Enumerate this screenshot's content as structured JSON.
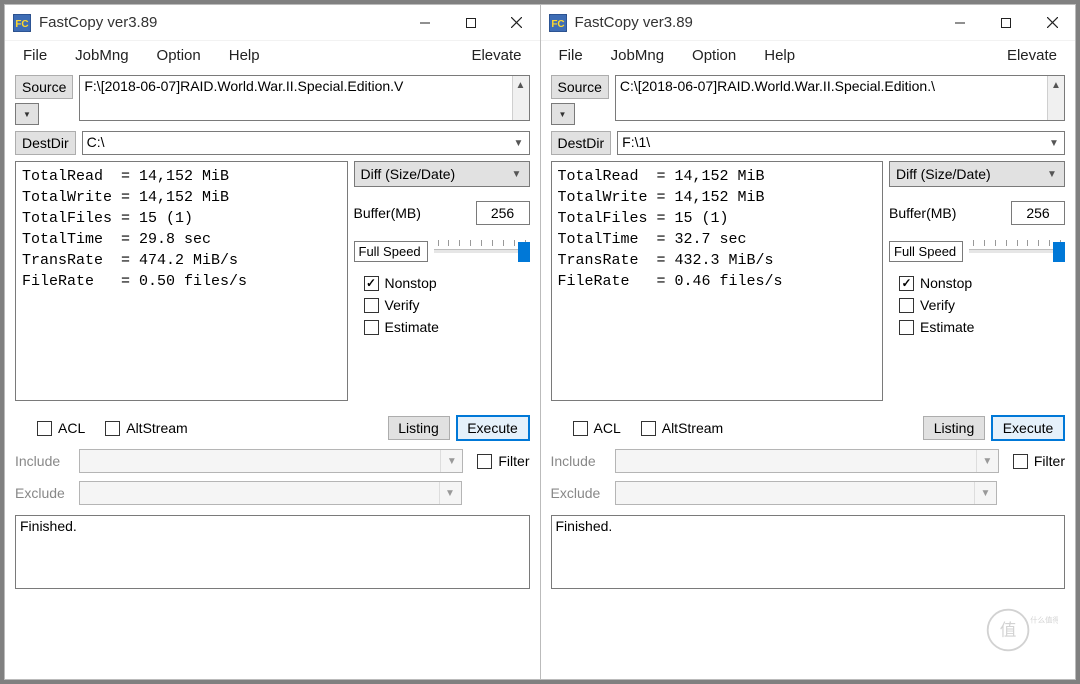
{
  "app": {
    "title": "FastCopy ver3.89",
    "menu": {
      "file": "File",
      "jobmng": "JobMng",
      "option": "Option",
      "help": "Help",
      "elevate": "Elevate"
    },
    "labels": {
      "source_btn": "Source",
      "destdir_btn": "DestDir",
      "buffer_label": "Buffer(MB)",
      "listing_btn": "Listing",
      "execute_btn": "Execute",
      "include_label": "Include",
      "exclude_label": "Exclude",
      "acl_label": "ACL",
      "altstream_label": "AltStream",
      "nonstop_label": "Nonstop",
      "verify_label": "Verify",
      "estimate_label": "Estimate",
      "filter_label": "Filter",
      "mode_value": "Diff (Size/Date)",
      "speed_value": "Full Speed"
    }
  },
  "windows": [
    {
      "source_path": "F:\\[2018-06-07]RAID.World.War.II.Special.Edition.V",
      "dest_path": "C:\\",
      "buffer_mb": "256",
      "stats_text": "TotalRead  = 14,152 MiB\nTotalWrite = 14,152 MiB\nTotalFiles = 15 (1)\nTotalTime  = 29.8 sec\nTransRate  = 474.2 MiB/s\nFileRate   = 0.50 files/s",
      "nonstop": true,
      "verify": false,
      "estimate": false,
      "acl": false,
      "altstream": false,
      "filter": false,
      "log_text": "Finished."
    },
    {
      "source_path": "C:\\[2018-06-07]RAID.World.War.II.Special.Edition.\\",
      "dest_path": "F:\\1\\",
      "buffer_mb": "256",
      "stats_text": "TotalRead  = 14,152 MiB\nTotalWrite = 14,152 MiB\nTotalFiles = 15 (1)\nTotalTime  = 32.7 sec\nTransRate  = 432.3 MiB/s\nFileRate   = 0.46 files/s",
      "nonstop": true,
      "verify": false,
      "estimate": false,
      "acl": false,
      "altstream": false,
      "filter": false,
      "log_text": "Finished."
    }
  ]
}
